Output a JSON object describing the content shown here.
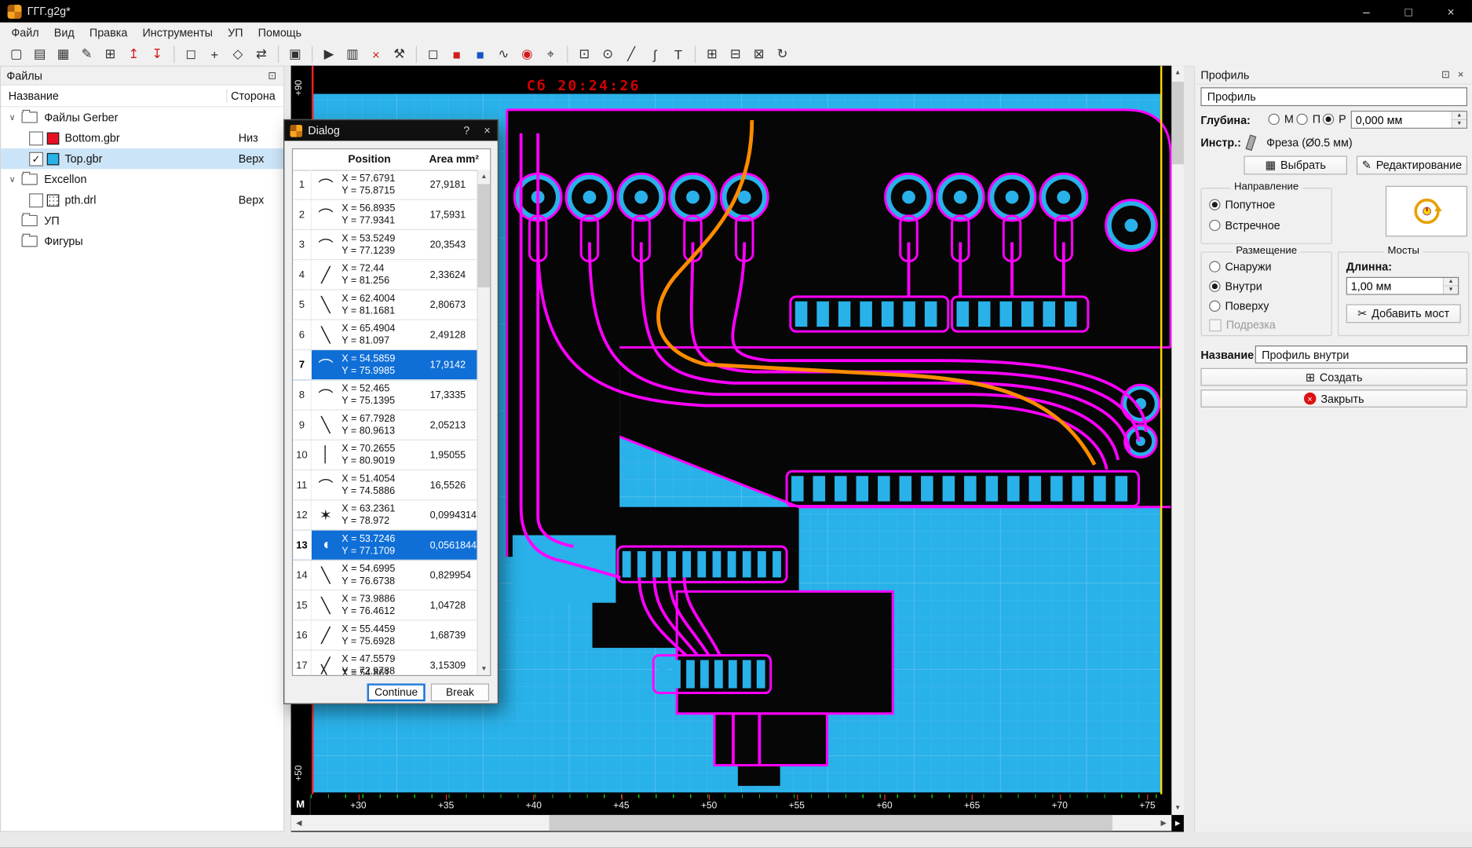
{
  "window": {
    "title": "ГГГ.g2g*"
  },
  "icons": {
    "expander": "∨",
    "dock": "⊡",
    "close": "×",
    "help": "?",
    "minimize": "–",
    "maximize": "□",
    "up": "▲",
    "down": "▼",
    "left": "◀",
    "right": "▶",
    "corner": "▶",
    "scissors": "✂",
    "pencil": "✎",
    "grid": "▦",
    "create": "⊞"
  },
  "menubar": {
    "items": [
      {
        "name": "menu-file",
        "label": "Файл"
      },
      {
        "name": "menu-view",
        "label": "Вид"
      },
      {
        "name": "menu-edit",
        "label": "Правка"
      },
      {
        "name": "menu-tools",
        "label": "Инструменты"
      },
      {
        "name": "menu-up",
        "label": "УП"
      },
      {
        "name": "menu-help",
        "label": "Помощь"
      }
    ]
  },
  "toolbar": {
    "items": [
      {
        "name": "new-file-button",
        "glyph": "▢"
      },
      {
        "name": "open-file-button",
        "glyph": "▤"
      },
      {
        "name": "save-file-button",
        "glyph": "▦"
      },
      {
        "name": "edit-file-button",
        "glyph": "✎"
      },
      {
        "name": "copy-file-button",
        "glyph": "⊞"
      },
      {
        "name": "import-gerber-button",
        "glyph": "↥",
        "cls": "red"
      },
      {
        "name": "export-gerber-button",
        "glyph": "↧",
        "cls": "red"
      },
      {
        "cls": "separator"
      },
      {
        "name": "select-tool-button",
        "glyph": "◻"
      },
      {
        "name": "move-tool-button",
        "glyph": "+"
      },
      {
        "name": "scale-tool-button",
        "glyph": "◇"
      },
      {
        "name": "mirror-tool-button",
        "glyph": "⇄"
      },
      {
        "cls": "separator"
      },
      {
        "name": "merge-tool-button",
        "glyph": "▣"
      },
      {
        "cls": "separator"
      },
      {
        "name": "run-button",
        "glyph": "▶"
      },
      {
        "name": "table-view-button",
        "glyph": "▥"
      },
      {
        "name": "delete-button",
        "glyph": "×",
        "cls": "red"
      },
      {
        "name": "drill-tool-button",
        "glyph": "⚒"
      },
      {
        "cls": "separator"
      },
      {
        "name": "layer-panel-button",
        "glyph": "◻"
      },
      {
        "name": "red-layer-button",
        "glyph": "■",
        "cls": "red"
      },
      {
        "name": "blue-layer-button",
        "glyph": "■",
        "cls": "blue"
      },
      {
        "name": "curve-edit-button",
        "glyph": "∿"
      },
      {
        "name": "snap-center-button",
        "glyph": "◉",
        "cls": "red"
      },
      {
        "name": "origin-tool-button",
        "glyph": "⌖"
      },
      {
        "cls": "separator"
      },
      {
        "name": "point-tool-button",
        "glyph": "⊡"
      },
      {
        "name": "circle-tool-button",
        "glyph": "⊙"
      },
      {
        "name": "line-tool-button",
        "glyph": "╱"
      },
      {
        "name": "spline-tool-button",
        "glyph": "ʃ"
      },
      {
        "name": "text-tool-button",
        "glyph": "T"
      },
      {
        "cls": "separator"
      },
      {
        "name": "group-button",
        "glyph": "⊞"
      },
      {
        "name": "ungroup-button",
        "glyph": "⊟"
      },
      {
        "name": "clone-button",
        "glyph": "⊠"
      },
      {
        "name": "rotate-button",
        "glyph": "↻"
      }
    ]
  },
  "files": {
    "title": "Файлы",
    "columns": [
      "Название",
      "Сторона"
    ],
    "rows": [
      {
        "kind": "folder",
        "label": "Файлы Gerber"
      },
      {
        "kind": "file",
        "label": "Bottom.gbr",
        "side": "Низ",
        "checked": false,
        "swatch": "red"
      },
      {
        "kind": "file",
        "label": "Top.gbr",
        "side": "Верх",
        "checked": true,
        "swatch": "cyan",
        "selected": true
      },
      {
        "kind": "folder",
        "label": "Excellon"
      },
      {
        "kind": "file",
        "label": "pth.drl",
        "side": "Верх",
        "checked": false,
        "swatch": "drill"
      },
      {
        "kind": "folder",
        "label": "УП"
      },
      {
        "kind": "folder",
        "label": "Фигуры"
      }
    ]
  },
  "canvas": {
    "clock": "Сб 20:24:26",
    "left_ruler": [
      "+90",
      "+50"
    ],
    "bottom_ruler": [
      "+30",
      "+35",
      "+40",
      "+45",
      "+50",
      "+55",
      "+60",
      "+65",
      "+70",
      "+75"
    ],
    "m_label": "М",
    "colors": {
      "background": "#29b1e9",
      "board": "#060606",
      "trace": "#ff00ff",
      "highlight": "#ff8b00",
      "guide": "#ffd800",
      "axis": "#ff2020",
      "clock": "#d40000"
    }
  },
  "dialog": {
    "title": "Dialog",
    "columns": [
      "Position",
      "Area mm²"
    ],
    "rows": [
      {
        "n": "1",
        "glyph": "⌒",
        "x": "X = 57.6791",
        "y": "Y = 75.8715",
        "area": "27,9181"
      },
      {
        "n": "2",
        "glyph": "⌒",
        "x": "X = 56.8935",
        "y": "Y = 77.9341",
        "area": "17,5931"
      },
      {
        "n": "3",
        "glyph": "⌒",
        "x": "X = 53.5249",
        "y": "Y = 77.1239",
        "area": "20,3543"
      },
      {
        "n": "4",
        "glyph": "╱",
        "x": "X = 72.44",
        "y": "Y = 81.256",
        "area": "2,33624"
      },
      {
        "n": "5",
        "glyph": "╲",
        "x": "X = 62.4004",
        "y": "Y = 81.1681",
        "area": "2,80673"
      },
      {
        "n": "6",
        "glyph": "╲",
        "x": "X = 65.4904",
        "y": "Y = 81.097",
        "area": "2,49128"
      },
      {
        "n": "7",
        "glyph": "⌒",
        "x": "X = 54.5859",
        "y": "Y = 75.9985",
        "area": "17,9142",
        "selected": true
      },
      {
        "n": "8",
        "glyph": "⌒",
        "x": "X = 52.465",
        "y": "Y = 75.1395",
        "area": "17,3335"
      },
      {
        "n": "9",
        "glyph": "╲",
        "x": "X = 67.7928",
        "y": "Y = 80.9613",
        "area": "2,05213"
      },
      {
        "n": "10",
        "glyph": "│",
        "x": "X = 70.2655",
        "y": "Y = 80.9019",
        "area": "1,95055"
      },
      {
        "n": "11",
        "glyph": "⌒",
        "x": "X = 51.4054",
        "y": "Y = 74.5886",
        "area": "16,5526"
      },
      {
        "n": "12",
        "glyph": "✶",
        "x": "X = 63.2361",
        "y": "Y = 78.972",
        "area": "0,0994314"
      },
      {
        "n": "13",
        "glyph": "◖",
        "x": "X = 53.7246",
        "y": "Y = 77.1709",
        "area": "0,0561844",
        "selected": true
      },
      {
        "n": "14",
        "glyph": "╲",
        "x": "X = 54.6995",
        "y": "Y = 76.6738",
        "area": "0,829954"
      },
      {
        "n": "15",
        "glyph": "╲",
        "x": "X = 73.9886",
        "y": "Y = 76.4612",
        "area": "1,04728"
      },
      {
        "n": "16",
        "glyph": "╱",
        "x": "X = 55.4459",
        "y": "Y = 75.6928",
        "area": "1,68739"
      },
      {
        "n": "17",
        "glyph": "╱",
        "x": "X = 47.5579",
        "y": "Y = 72.9788",
        "area": "3,15309"
      }
    ],
    "partial_row": {
      "glyph": "╲",
      "x": "X = 54.861"
    },
    "buttons": {
      "continue": "Continue",
      "break": "Break"
    }
  },
  "profile": {
    "header": "Профиль",
    "combo_value": "Профиль",
    "depth": {
      "label": "Глубина:",
      "options": [
        {
          "label": "М"
        },
        {
          "label": "П"
        },
        {
          "label": "Р",
          "checked": true
        }
      ],
      "value": "0,000 мм"
    },
    "tool": {
      "label": "Инстр.:",
      "value": "Фреза (Ø0.5 мм)"
    },
    "select_button": "Выбрать",
    "edit_button": "Редактирование",
    "direction": {
      "title": "Направление",
      "options": [
        {
          "label": "Попутное",
          "checked": true
        },
        {
          "label": "Встречное"
        }
      ]
    },
    "placement": {
      "title": "Размещение",
      "options": [
        {
          "label": "Снаружи"
        },
        {
          "label": "Внутри",
          "checked": true
        },
        {
          "label": "Поверху"
        }
      ],
      "trim": {
        "label": "Подрезка",
        "checked": false
      }
    },
    "bridges": {
      "title": "Мосты",
      "length_label": "Длинна:",
      "length_value": "1,00 мм",
      "add_button": "Добавить мост"
    },
    "name": {
      "label": "Название:",
      "value": "Профиль внутри"
    },
    "create_button": "Создать",
    "close_button": "Закрыть"
  }
}
